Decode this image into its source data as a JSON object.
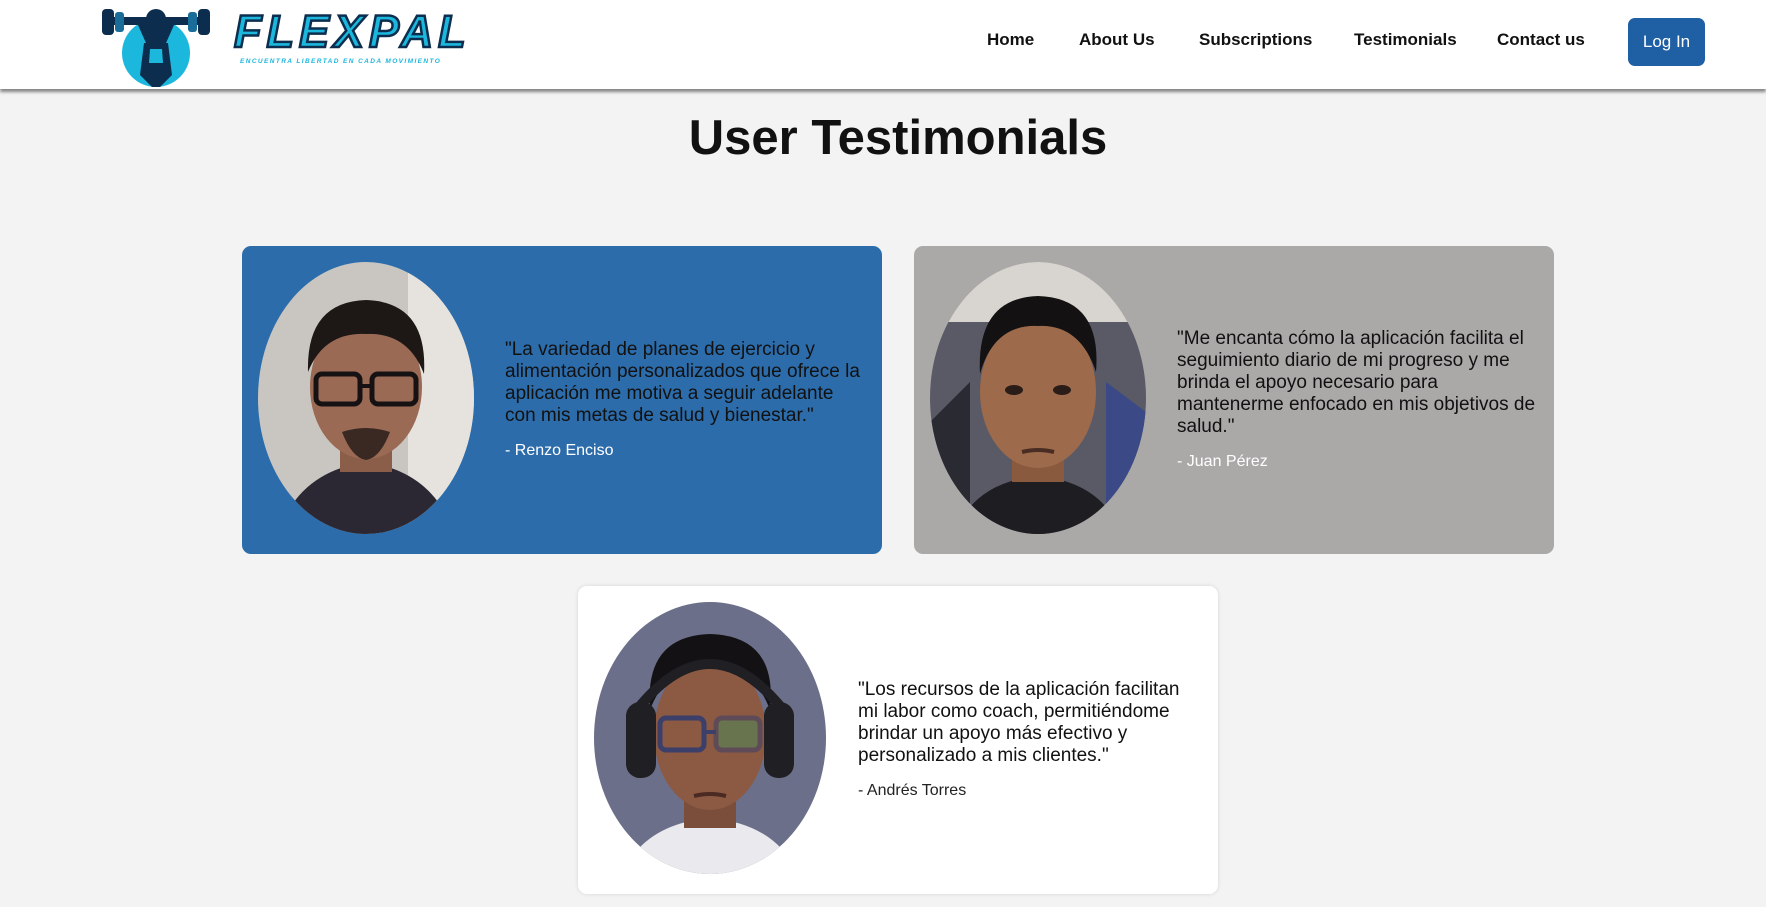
{
  "brand": {
    "name": "FLEXPAL",
    "tagline": "ENCUENTRA LIBERTAD EN CADA MOVIMIENTO",
    "colors": {
      "primary": "#1bb7dd",
      "outline": "#0c2d4d"
    }
  },
  "nav": {
    "items": [
      {
        "label": "Home"
      },
      {
        "label": "About Us"
      },
      {
        "label": "Subscriptions"
      },
      {
        "label": "Testimonials"
      },
      {
        "label": "Contact us"
      }
    ],
    "login_label": "Log In"
  },
  "page": {
    "title": "User Testimonials"
  },
  "testimonials": [
    {
      "quote": "\"La variedad de planes de ejercicio y alimentación personalizados que ofrece la aplicación me motiva a seguir adelante con mis metas de salud y bienestar.\"",
      "author": "- Renzo Enciso",
      "card_color": "#2c6cab"
    },
    {
      "quote": "\"Me encanta cómo la aplicación facilita el seguimiento diario de mi progreso y me brinda el apoyo necesario para mantenerme enfocado en mis objetivos de salud.\"",
      "author": "- Juan Pérez",
      "card_color": "#aba9a8"
    },
    {
      "quote": "\"Los recursos de la aplicación facilitan mi labor como coach, permitiéndome brindar un apoyo más efectivo y personalizado a mis clientes.\"",
      "author": "- Andrés Torres",
      "card_color": "#ffffff"
    }
  ],
  "colors": {
    "page_bg": "#f3f3f3",
    "accent": "#1f5fa4"
  }
}
